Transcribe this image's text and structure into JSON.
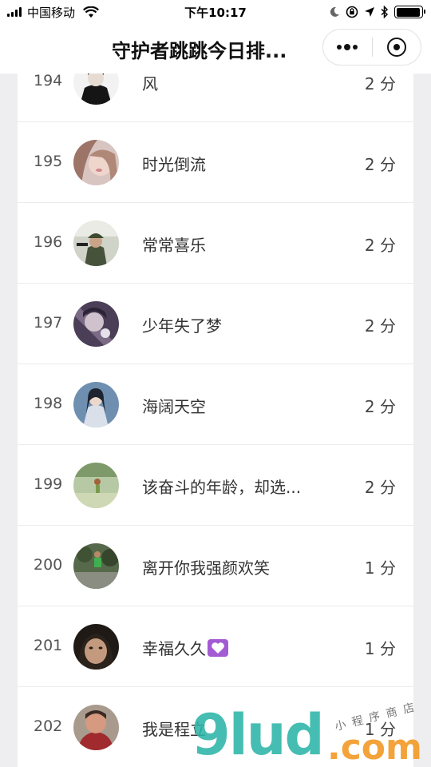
{
  "status_bar": {
    "carrier": "中国移动",
    "time": "下午10:17",
    "battery_level": 0.95
  },
  "nav": {
    "title": "守护者跳跳今日排...",
    "more_icon": "more-dots-icon",
    "close_icon": "target-close-icon"
  },
  "ranking": {
    "score_unit": "分",
    "rows": [
      {
        "rank": "194",
        "name": "风",
        "score": "2 分",
        "avatar": "avatar-194"
      },
      {
        "rank": "195",
        "name": "时光倒流",
        "score": "2 分",
        "avatar": "avatar-195"
      },
      {
        "rank": "196",
        "name": "常常喜乐",
        "score": "2 分",
        "avatar": "avatar-196"
      },
      {
        "rank": "197",
        "name": "少年失了梦",
        "score": "2 分",
        "avatar": "avatar-197"
      },
      {
        "rank": "198",
        "name": "海阔天空",
        "score": "2 分",
        "avatar": "avatar-198"
      },
      {
        "rank": "199",
        "name": "该奋斗的年龄，却选...",
        "score": "2 分",
        "avatar": "avatar-199"
      },
      {
        "rank": "200",
        "name": "离开你我强颜欢笑",
        "score": "1 分",
        "avatar": "avatar-200"
      },
      {
        "rank": "201",
        "name": "幸福久久",
        "score": "1 分",
        "avatar": "avatar-201",
        "emoji": "purple-heart"
      },
      {
        "rank": "202",
        "name": "我是程立",
        "score": "1 分",
        "avatar": "avatar-202"
      }
    ]
  },
  "watermark": {
    "logo": "9lud",
    "suffix": ".com",
    "tag": "小程序商店"
  },
  "colors": {
    "accent_watermark": "#2db5a8",
    "watermark_orange": "#f29a25",
    "emoji_purple": "#a35bd4"
  }
}
